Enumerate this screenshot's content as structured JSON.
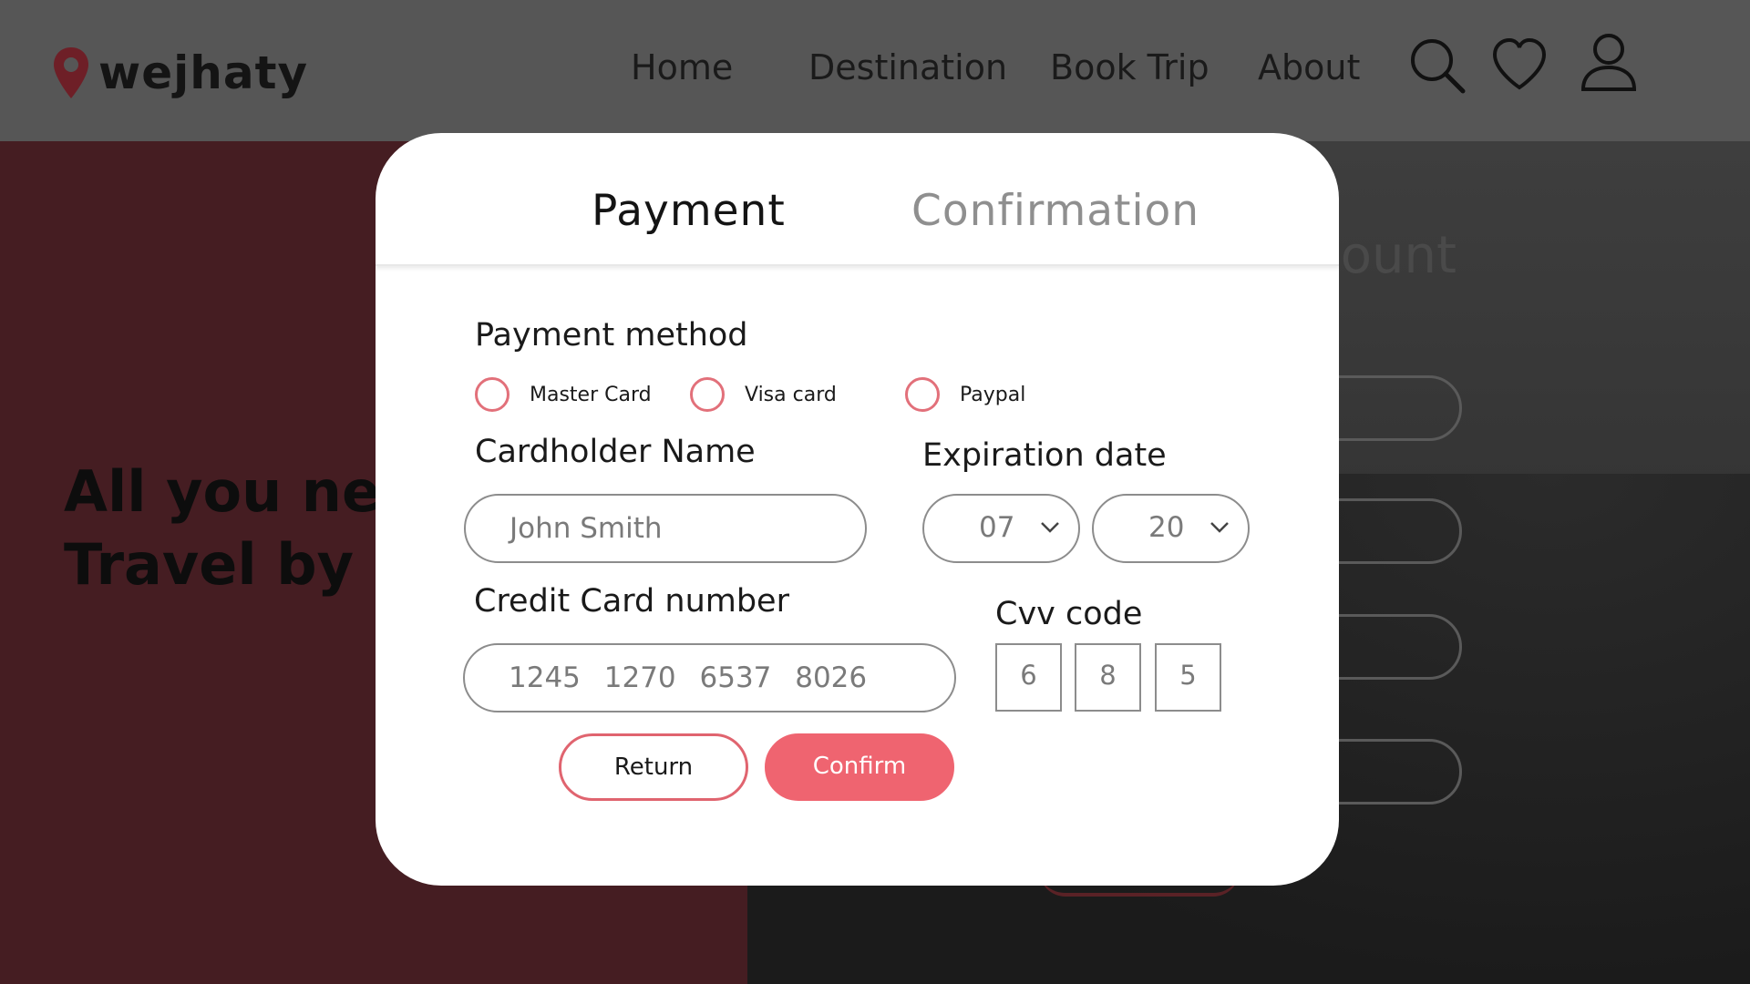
{
  "header": {
    "brand": "wejhaty",
    "nav": [
      "Home",
      "Destination",
      "Book Trip",
      "About"
    ],
    "icons": [
      "search-icon",
      "heart-icon",
      "user-icon"
    ]
  },
  "hero": {
    "line1": "All you nee",
    "line2": "Travel by o"
  },
  "background": {
    "heading_fragment": "count"
  },
  "modal": {
    "tabs": {
      "payment": "Payment",
      "confirmation": "Confirmation"
    },
    "payment_method": {
      "label": "Payment method",
      "options": [
        "Master Card",
        "Visa card",
        "Paypal"
      ]
    },
    "cardholder": {
      "label": "Cardholder Name",
      "value": "John Smith"
    },
    "expiration": {
      "label": "Expiration date",
      "month": "07",
      "year": "20"
    },
    "card_number": {
      "label": "Credit Card number",
      "value": "1245 1270 6537 8026"
    },
    "cvv": {
      "label": "Cvv code",
      "digits": [
        "6",
        "8",
        "5"
      ]
    },
    "buttons": {
      "return": "Return",
      "confirm": "Confirm"
    }
  },
  "colors": {
    "accent": "#ef6470",
    "radio_border": "#e2707a",
    "hero_left": "#451d22",
    "topbar": "#565656"
  }
}
